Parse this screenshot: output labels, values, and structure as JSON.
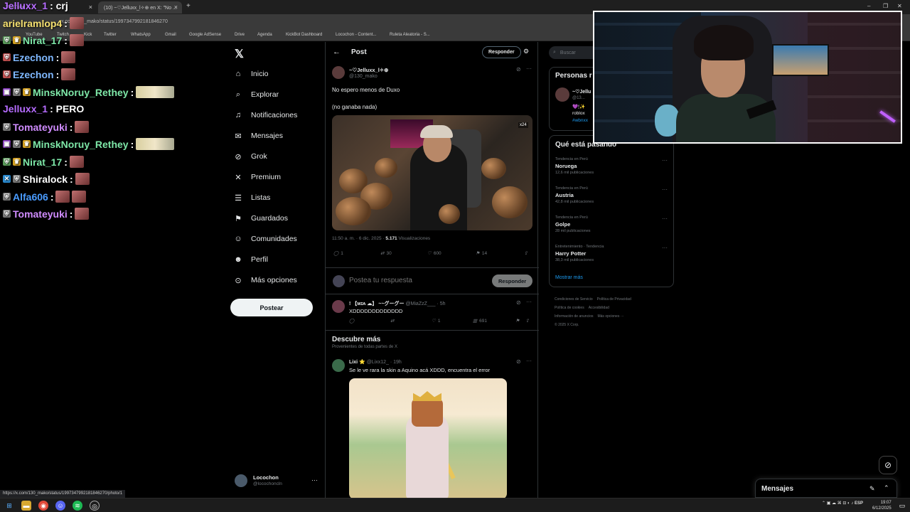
{
  "browser": {
    "tabs": [
      {
        "label": "YouTube",
        "active": false
      },
      {
        "label": "(10) ~♡Jelluxx_l✧⊕ en X: \"No ...",
        "active": true
      }
    ],
    "url": "x.com/130_mako/status/1997347992181846270",
    "bookmarks": [
      "YouTube",
      "Twitch",
      "Kick",
      "Twitter",
      "WhatsApp",
      "Gmail",
      "Google AdSense",
      "Drive",
      "Agenda",
      "KickBot Dashboard",
      "Locochon - Content...",
      "Ruleta Aleatoria - S..."
    ],
    "status_url": "https://x.com/130_mako/status/1997347992181846270/photo/1"
  },
  "chat": {
    "stream_title": "Jelluxx_1",
    "stream_title_suffix": ": crj",
    "messages": [
      {
        "user": "arielramlop4",
        "text": ":",
        "color": "#f5e070",
        "badges": [],
        "emotes": 1
      },
      {
        "user": "Nirat_17",
        "text": ":",
        "color": "#7ee8a8",
        "badges": [
          "shield",
          "crown"
        ],
        "emotes": 1
      },
      {
        "user": "Ezechon",
        "text": ":",
        "color": "#7fb8ff",
        "badges": [
          "shield"
        ],
        "emotes": 1
      },
      {
        "user": "Ezechon",
        "text": ":",
        "color": "#7fb8ff",
        "badges": [
          "shield"
        ],
        "emotes": 1
      },
      {
        "user": "MinskNoruy_Rethey",
        "text": ":",
        "color": "#7ee8a8",
        "badges": [
          "gift",
          "shield",
          "crown"
        ],
        "emotes": 0,
        "wide": true
      },
      {
        "user": "Jelluxx_1",
        "text": ": PERO",
        "color": "#b66cff",
        "badges": [],
        "emotes": 0
      },
      {
        "user": "Tomateyuki",
        "text": ":",
        "color": "#d08cff",
        "badges": [
          "shield"
        ],
        "emotes": 1
      },
      {
        "user": "MinskNoruy_Rethey",
        "text": ":",
        "color": "#7ee8a8",
        "badges": [
          "gift",
          "shield",
          "crown"
        ],
        "emotes": 0,
        "wide": true
      },
      {
        "user": "Nirat_17",
        "text": ":",
        "color": "#7ee8a8",
        "badges": [
          "shield",
          "crown"
        ],
        "emotes": 1
      },
      {
        "user": "Shiralock",
        "text": ":",
        "color": "#ffffff",
        "badges": [
          "x",
          "shield"
        ],
        "emotes": 1
      },
      {
        "user": "Alfa606",
        "text": ":",
        "color": "#4a9cff",
        "badges": [
          "shield"
        ],
        "emotes": 2
      },
      {
        "user": "Tomateyuki",
        "text": ":",
        "color": "#d08cff",
        "badges": [
          "shield"
        ],
        "emotes": 1
      }
    ]
  },
  "nav": {
    "items": [
      {
        "label": "Inicio",
        "icon": "home-icon",
        "glyph": "⌂"
      },
      {
        "label": "Explorar",
        "icon": "search-icon",
        "glyph": "⌕"
      },
      {
        "label": "Notificaciones",
        "icon": "bell-icon",
        "glyph": "🔔"
      },
      {
        "label": "Mensajes",
        "icon": "mail-icon",
        "glyph": "✉"
      },
      {
        "label": "Grok",
        "icon": "grok-icon",
        "glyph": "⊘"
      },
      {
        "label": "Premium",
        "icon": "x-icon",
        "glyph": "𝕏"
      },
      {
        "label": "Listas",
        "icon": "list-icon",
        "glyph": "☰"
      },
      {
        "label": "Guardados",
        "icon": "bookmark-icon",
        "glyph": "🔖"
      },
      {
        "label": "Comunidades",
        "icon": "people-icon",
        "glyph": "👥"
      },
      {
        "label": "Perfil",
        "icon": "person-icon",
        "glyph": "👤"
      },
      {
        "label": "Más opciones",
        "icon": "more-circle-icon",
        "glyph": "⋯"
      }
    ],
    "post_button": "Postear",
    "account": {
      "name": "Locochon",
      "handle": "@locochoncln"
    }
  },
  "post": {
    "header_title": "Post",
    "reply_button": "Responder",
    "author": "~♡Jelluxx_l✧⊕",
    "handle": "@130_mako",
    "text_line1": "No espero menos de Duxo",
    "text_line2": "(no ganaba nada)",
    "image_badge": "x24",
    "timestamp": "11:50 a. m. · 6 dic. 2025 ·",
    "views": "5.171",
    "views_label": "Visualizaciones",
    "replies": "1",
    "reposts": "30",
    "likes": "600",
    "bookmarks": "14"
  },
  "compose": {
    "placeholder": "Postea tu respuesta",
    "button": "Responder"
  },
  "reply": {
    "author": "! 【ᴍɪᴀ ☁】 ~~グーグー",
    "handle": "@MiaZzZ___ · 5h",
    "text": "XDDDDDDDDDDDDD",
    "likes": "1",
    "views": "691"
  },
  "discover": {
    "title": "Descubre más",
    "subtitle": "Provenientes de todas partes de X",
    "tweet": {
      "author": "Lixi ⭐",
      "handle": "@Lixx12_ · 19h",
      "text": "Se le ve rara la skin a Aquino acá XDDD, encuentra el error"
    }
  },
  "right": {
    "search_placeholder": "Buscar",
    "people_title": "Personas r",
    "person": {
      "name": "~♡Jellu",
      "handle": "@13...",
      "bio1": "💜🕯✨",
      "bio2": "roblox",
      "tag": "#wbnxx"
    },
    "trends_title": "Qué está pasando",
    "trends": [
      {
        "context": "Tendencia en Perú",
        "name": "Noruega",
        "count": "12,6 mil publicaciones"
      },
      {
        "context": "Tendencia en Perú",
        "name": "Austria",
        "count": "42,8 mil publicaciones"
      },
      {
        "context": "Tendencia en Perú",
        "name": "Golpe",
        "count": "28 mil publicaciones"
      },
      {
        "context": "Entretenimiento · Tendencia",
        "name": "Harry Potter",
        "count": "38,3 mil publicaciones"
      }
    ],
    "show_more": "Mostrar más",
    "footer": [
      "Condiciones de Servicio",
      "Política de Privacidad",
      "Política de cookies",
      "Accesibilidad",
      "Información de anuncios",
      "Más opciones ···",
      "© 2025 X Corp."
    ]
  },
  "messages_drawer": {
    "title": "Mensajes"
  },
  "taskbar": {
    "lang": "ESP",
    "time": "19:07",
    "date": "6/12/2025"
  }
}
